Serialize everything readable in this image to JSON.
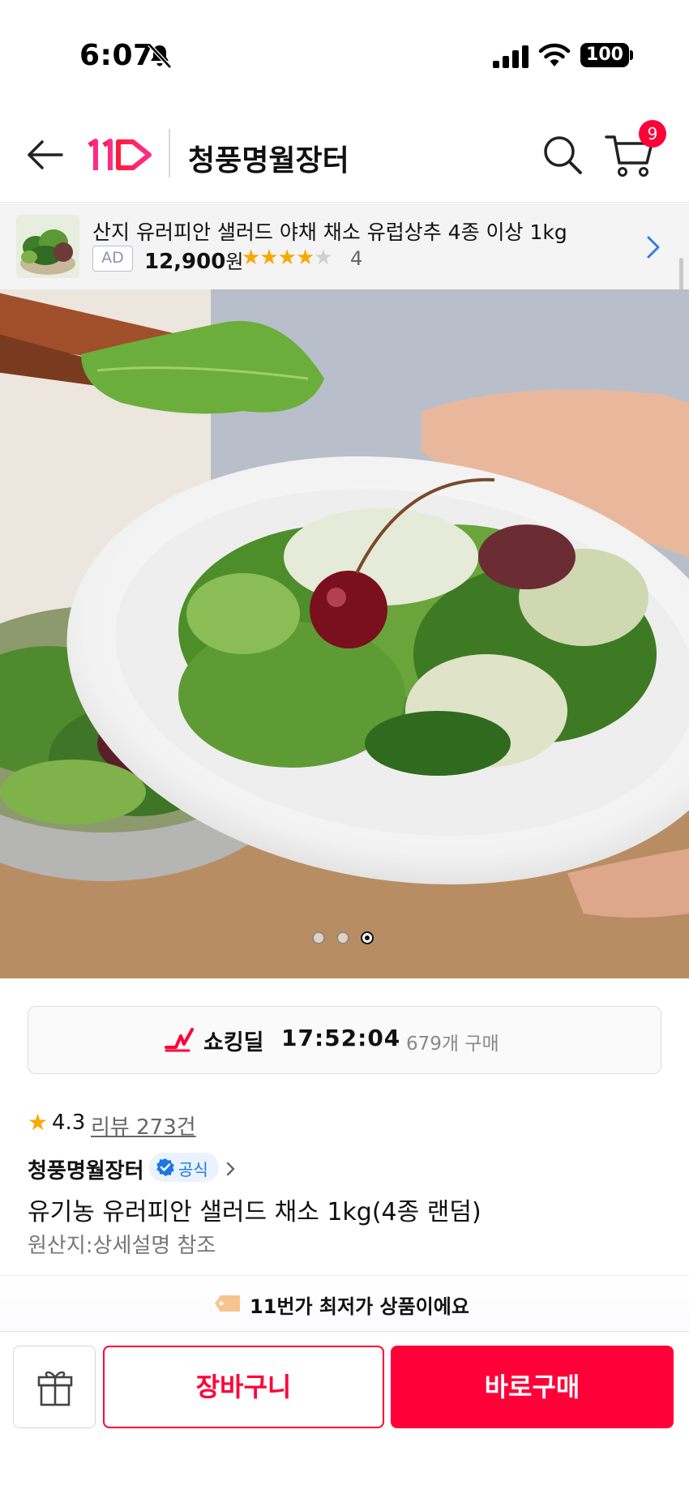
{
  "status_bar": {
    "time": "6:07",
    "battery": "100"
  },
  "header": {
    "store_title": "청풍명월장터",
    "cart_count": "9"
  },
  "ad": {
    "title": "산지 유러피안 샐러드 야채 채소 유럽상추 4종 이상 1kg",
    "badge": "AD",
    "price": "12,900",
    "price_unit": "원",
    "stars_filled": 4,
    "stars_total": 5,
    "rating_count": "4"
  },
  "hero": {
    "image_count": 3,
    "active_index": 2
  },
  "deal": {
    "label": "쇼킹딜",
    "timer": "17:52:04",
    "count": "679개 구매"
  },
  "product": {
    "rating": "4.3",
    "review_link": "리뷰 273건",
    "seller": "청풍명월장터",
    "official_label": "공식",
    "title": "유기농 유러피안 샐러드 채소 1kg(4종 랜덤)",
    "origin": "원산지:상세설명 참조"
  },
  "lowest": {
    "text": "11번가 최저가 상품이에요"
  },
  "bottom_bar": {
    "cart_label": "장바구니",
    "buy_label": "바로구매"
  },
  "colors": {
    "brand": "#ff0038",
    "star": "#f8a900",
    "official": "#1c78e0"
  }
}
